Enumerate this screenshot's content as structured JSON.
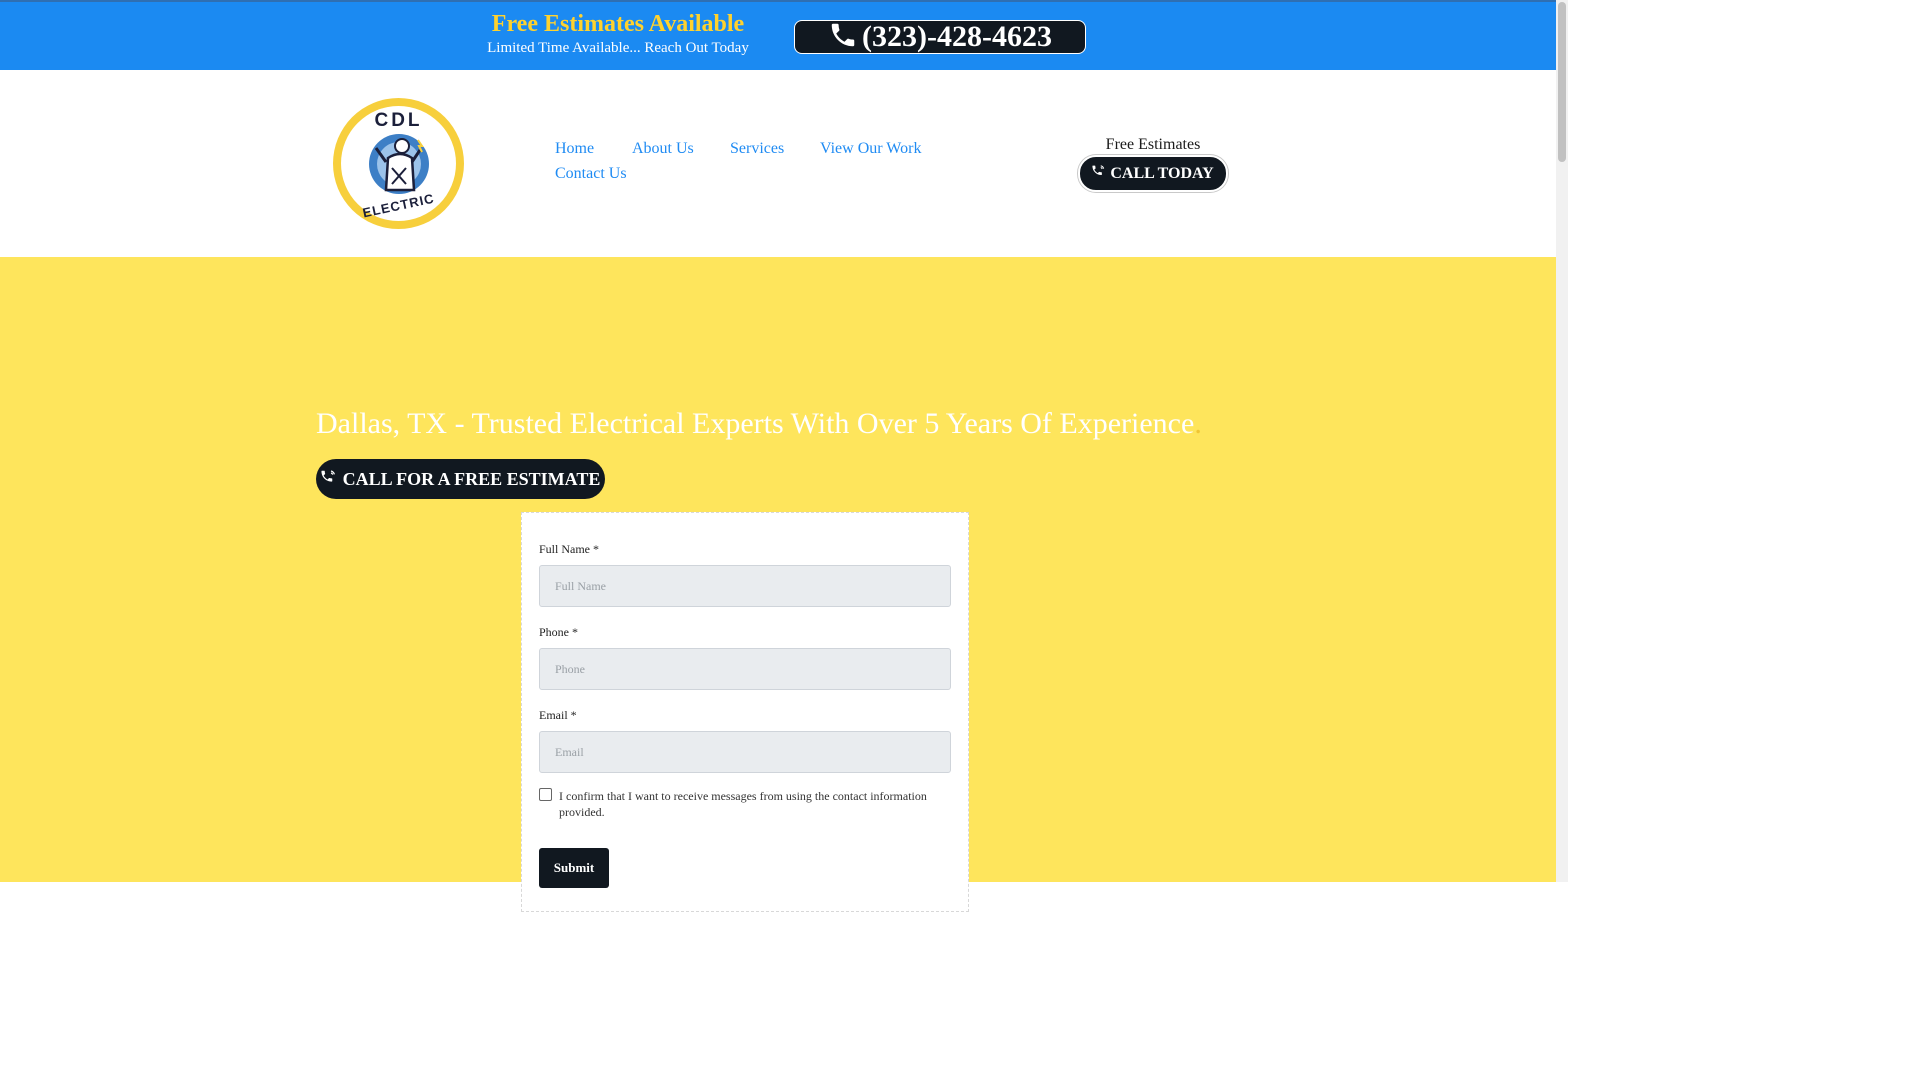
{
  "topbar": {
    "promo_title": "Free Estimates Available",
    "promo_subtitle": "Limited Time Available... Reach Out Today",
    "phone": "(323)-428-4623",
    "colors": {
      "background": "#1b8af2",
      "title": "#ffd22e"
    }
  },
  "logo": {
    "top": "CDL",
    "bottom": "ELECTRIC"
  },
  "nav": {
    "items": [
      {
        "label": "Home"
      },
      {
        "label": "About Us"
      },
      {
        "label": "Services"
      },
      {
        "label": "View Our Work"
      },
      {
        "label": "Contact Us"
      }
    ]
  },
  "header_cta": {
    "caption": "Free Estimates",
    "button": "CALL TODAY"
  },
  "hero": {
    "title": "Dallas, TX - Trusted Electrical Experts With Over 5 Years Of Experience",
    "title_end": ".",
    "button": "CALL FOR A FREE ESTIMATE",
    "background": "#fee55c"
  },
  "form": {
    "full_name_label": "Full Name *",
    "full_name_placeholder": "Full Name",
    "phone_label": "Phone *",
    "phone_placeholder": "Phone",
    "email_label": "Email *",
    "email_placeholder": "Email",
    "consent": "I confirm that I want to receive messages from using the contact information provided.",
    "consent_checked": false,
    "submit": "Submit"
  },
  "icons": {
    "phone": "phone-icon",
    "phone_ring": "phone-ringing-icon"
  }
}
